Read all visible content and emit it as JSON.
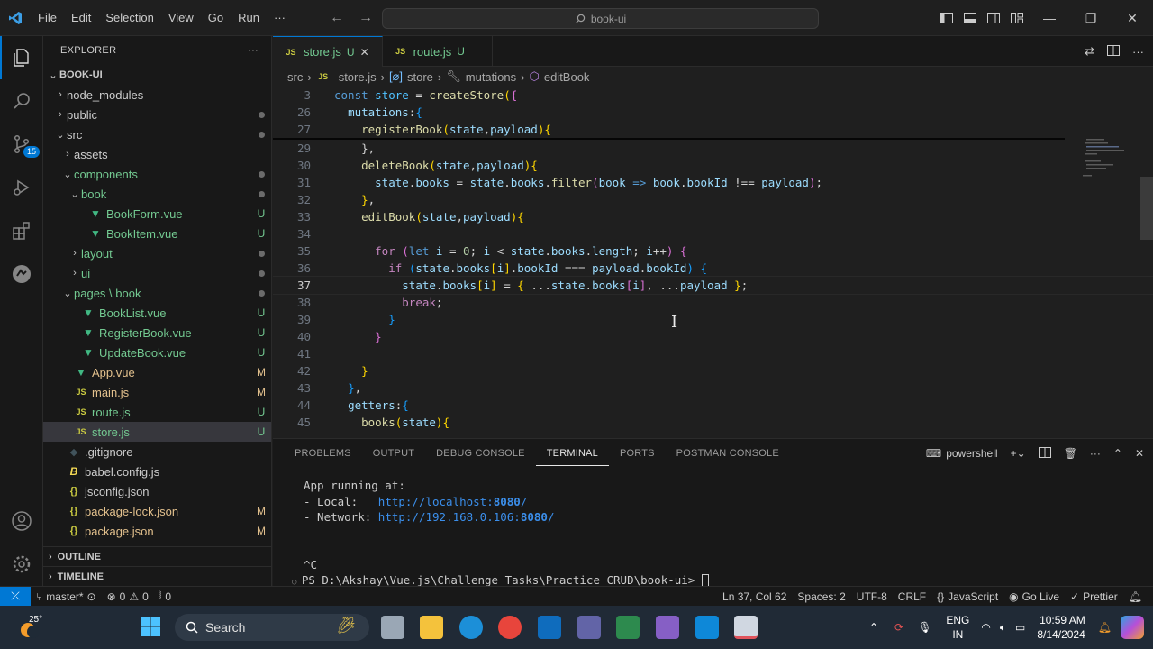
{
  "window": {
    "menu": [
      "File",
      "Edit",
      "Selection",
      "View",
      "Go",
      "Run",
      "···"
    ],
    "search_text": "book-ui"
  },
  "activity_badge": "15",
  "explorer": {
    "header": "EXPLORER",
    "root": "BOOK-UI",
    "items": [
      {
        "label": "node_modules",
        "indent": 1,
        "kind": "folder",
        "open": false,
        "status": "",
        "color": "grey"
      },
      {
        "label": "public",
        "indent": 1,
        "kind": "folder",
        "open": false,
        "status": "dot",
        "color": "grey"
      },
      {
        "label": "src",
        "indent": 1,
        "kind": "folder",
        "open": true,
        "status": "dot",
        "color": "grey"
      },
      {
        "label": "assets",
        "indent": 2,
        "kind": "folder",
        "open": false,
        "status": "",
        "color": "grey"
      },
      {
        "label": "components",
        "indent": 2,
        "kind": "folder",
        "open": true,
        "status": "dot",
        "color": "green"
      },
      {
        "label": "book",
        "indent": 3,
        "kind": "folder",
        "open": true,
        "status": "dot",
        "color": "green"
      },
      {
        "label": "BookForm.vue",
        "indent": 4,
        "kind": "vue",
        "status": "U",
        "color": "green"
      },
      {
        "label": "BookItem.vue",
        "indent": 4,
        "kind": "vue",
        "status": "U",
        "color": "green"
      },
      {
        "label": "layout",
        "indent": 3,
        "kind": "folder",
        "open": false,
        "status": "dot",
        "color": "green"
      },
      {
        "label": "ui",
        "indent": 3,
        "kind": "folder",
        "open": false,
        "status": "dot",
        "color": "green"
      },
      {
        "label": "pages \\ book",
        "indent": 2,
        "kind": "folder",
        "open": true,
        "status": "dot",
        "color": "green"
      },
      {
        "label": "BookList.vue",
        "indent": 3,
        "kind": "vue",
        "status": "U",
        "color": "green"
      },
      {
        "label": "RegisterBook.vue",
        "indent": 3,
        "kind": "vue",
        "status": "U",
        "color": "green"
      },
      {
        "label": "UpdateBook.vue",
        "indent": 3,
        "kind": "vue",
        "status": "U",
        "color": "green"
      },
      {
        "label": "App.vue",
        "indent": 2,
        "kind": "vue",
        "status": "M",
        "color": "mod"
      },
      {
        "label": "main.js",
        "indent": 2,
        "kind": "js",
        "status": "M",
        "color": "mod"
      },
      {
        "label": "route.js",
        "indent": 2,
        "kind": "js",
        "status": "U",
        "color": "green"
      },
      {
        "label": "store.js",
        "indent": 2,
        "kind": "js",
        "status": "U",
        "color": "green",
        "selected": true
      },
      {
        "label": ".gitignore",
        "indent": 1,
        "kind": "git",
        "status": "",
        "color": "grey"
      },
      {
        "label": "babel.config.js",
        "indent": 1,
        "kind": "babel",
        "status": "",
        "color": "grey"
      },
      {
        "label": "jsconfig.json",
        "indent": 1,
        "kind": "json",
        "status": "",
        "color": "grey"
      },
      {
        "label": "package-lock.json",
        "indent": 1,
        "kind": "json",
        "status": "M",
        "color": "mod"
      },
      {
        "label": "package.json",
        "indent": 1,
        "kind": "json",
        "status": "M",
        "color": "mod"
      }
    ],
    "outline": "OUTLINE",
    "timeline": "TIMELINE"
  },
  "tabs": [
    {
      "label": "store.js",
      "status": "U",
      "active": true,
      "close": "✕"
    },
    {
      "label": "route.js",
      "status": "U",
      "active": false,
      "close": ""
    }
  ],
  "breadcrumb": {
    "src": "src",
    "file": "store.js",
    "store": "store",
    "mutations": "mutations",
    "method": "editBook"
  },
  "code": {
    "sticky": [
      {
        "n": "3",
        "html": "<span class='kw'>const</span> <span class='vc'>store</span> <span class='op'>=</span> <span class='fn'>createStore</span><span class='br1'>(</span><span class='br2'>{</span>"
      },
      {
        "n": "26",
        "html": "  <span class='var'>mutations</span><span class='op'>:</span><span class='br3'>{</span>"
      },
      {
        "n": "27",
        "html": "    <span class='fn'>registerBook</span><span class='br1'>(</span><span class='var'>state</span><span class='op'>,</span><span class='var'>payload</span><span class='br1'>)</span><span class='br1'>{</span>"
      }
    ],
    "lines": [
      {
        "n": "29",
        "html": "    <span class='op'>},</span>"
      },
      {
        "n": "30",
        "html": "    <span class='fn'>deleteBook</span><span class='br1'>(</span><span class='var'>state</span><span class='op'>,</span><span class='var'>payload</span><span class='br1'>){</span>"
      },
      {
        "n": "31",
        "html": "      <span class='var'>state</span><span class='op'>.</span><span class='var'>books</span> <span class='op'>=</span> <span class='var'>state</span><span class='op'>.</span><span class='var'>books</span><span class='op'>.</span><span class='fn'>filter</span><span class='br2'>(</span><span class='var'>book</span> <span class='kw'>=&gt;</span> <span class='var'>book</span><span class='op'>.</span><span class='var'>bookId</span> <span class='op'>!==</span> <span class='var'>payload</span><span class='br2'>)</span><span class='op'>;</span>"
      },
      {
        "n": "32",
        "html": "    <span class='br1'>}</span><span class='op'>,</span>"
      },
      {
        "n": "33",
        "html": "    <span class='fn'>editBook</span><span class='br1'>(</span><span class='var'>state</span><span class='op'>,</span><span class='var'>payload</span><span class='br1'>){</span>"
      },
      {
        "n": "34",
        "html": ""
      },
      {
        "n": "35",
        "html": "      <span class='kc'>for</span> <span class='br2'>(</span><span class='kw'>let</span> <span class='var'>i</span> <span class='op'>=</span> <span class='num'>0</span><span class='op'>;</span> <span class='var'>i</span> <span class='op'>&lt;</span> <span class='var'>state</span><span class='op'>.</span><span class='var'>books</span><span class='op'>.</span><span class='var'>length</span><span class='op'>;</span> <span class='var'>i</span><span class='op'>++</span><span class='br2'>)</span> <span class='br2'>{</span>"
      },
      {
        "n": "36",
        "html": "        <span class='kc'>if</span> <span class='br3'>(</span><span class='var'>state</span><span class='op'>.</span><span class='var'>books</span><span class='br1'>[</span><span class='var'>i</span><span class='br1'>]</span><span class='op'>.</span><span class='var'>bookId</span> <span class='op'>===</span> <span class='var'>payload</span><span class='op'>.</span><span class='var'>bookId</span><span class='br3'>)</span> <span class='br3'>{</span>"
      },
      {
        "n": "37",
        "html": "          <span class='var'>state</span><span class='op'>.</span><span class='var'>books</span><span class='br1'>[</span><span class='var'>i</span><span class='br1'>]</span> <span class='op'>=</span> <span class='br1'>{</span> <span class='op'>...</span><span class='var'>state</span><span class='op'>.</span><span class='var'>books</span><span class='br2'>[</span><span class='var'>i</span><span class='br2'>]</span><span class='op'>,</span> <span class='op'>...</span><span class='var'>payload</span> <span class='br1'>}</span><span class='op'>;</span>",
        "current": true
      },
      {
        "n": "38",
        "html": "          <span class='kc'>break</span><span class='op'>;</span>"
      },
      {
        "n": "39",
        "html": "        <span class='br3'>}</span>"
      },
      {
        "n": "40",
        "html": "      <span class='br2'>}</span>"
      },
      {
        "n": "41",
        "html": ""
      },
      {
        "n": "42",
        "html": "    <span class='br1'>}</span>"
      },
      {
        "n": "43",
        "html": "  <span class='br3'>}</span><span class='op'>,</span>"
      },
      {
        "n": "44",
        "html": "  <span class='var'>getters</span><span class='op'>:</span><span class='br3'>{</span>"
      },
      {
        "n": "45",
        "html": "    <span class='fn'>books</span><span class='br1'>(</span><span class='var'>state</span><span class='br1'>){</span>"
      }
    ]
  },
  "panel": {
    "tabs": [
      "PROBLEMS",
      "OUTPUT",
      "DEBUG CONSOLE",
      "TERMINAL",
      "PORTS",
      "POSTMAN CONSOLE"
    ],
    "active_tab": "TERMINAL",
    "shell": "powershell",
    "terminal": {
      "l1": "App running at:",
      "local_label": "- Local:   ",
      "local_url_a": "http://localhost:",
      "local_url_port": "8080",
      "local_url_tail": "/",
      "net_label": "- Network: ",
      "net_url_a": "http://192.168.0.106:",
      "net_url_port": "8080",
      "net_url_tail": "/",
      "ctrl": "^C",
      "prompt": "PS D:\\Akshay\\Vue.js\\Challenge Tasks\\Practice CRUD\\book-ui> "
    }
  },
  "status": {
    "branch": "master*",
    "errors": "0",
    "warnings": "0",
    "ports": "0",
    "position": "Ln 37, Col 62",
    "spaces": "Spaces: 2",
    "encoding": "UTF-8",
    "eol": "CRLF",
    "language": "JavaScript",
    "golive": "Go Live",
    "prettier": "Prettier"
  },
  "taskbar": {
    "temp": "25°",
    "search": "Search",
    "lang1": "ENG",
    "lang2": "IN",
    "time": "10:59 AM",
    "date": "8/14/2024"
  },
  "colors": {
    "accent": "#0078d4",
    "editor_bg": "#1f1f1f",
    "sidebar_bg": "#181818",
    "git_untracked": "#73c991",
    "git_modified": "#e2c08d"
  }
}
